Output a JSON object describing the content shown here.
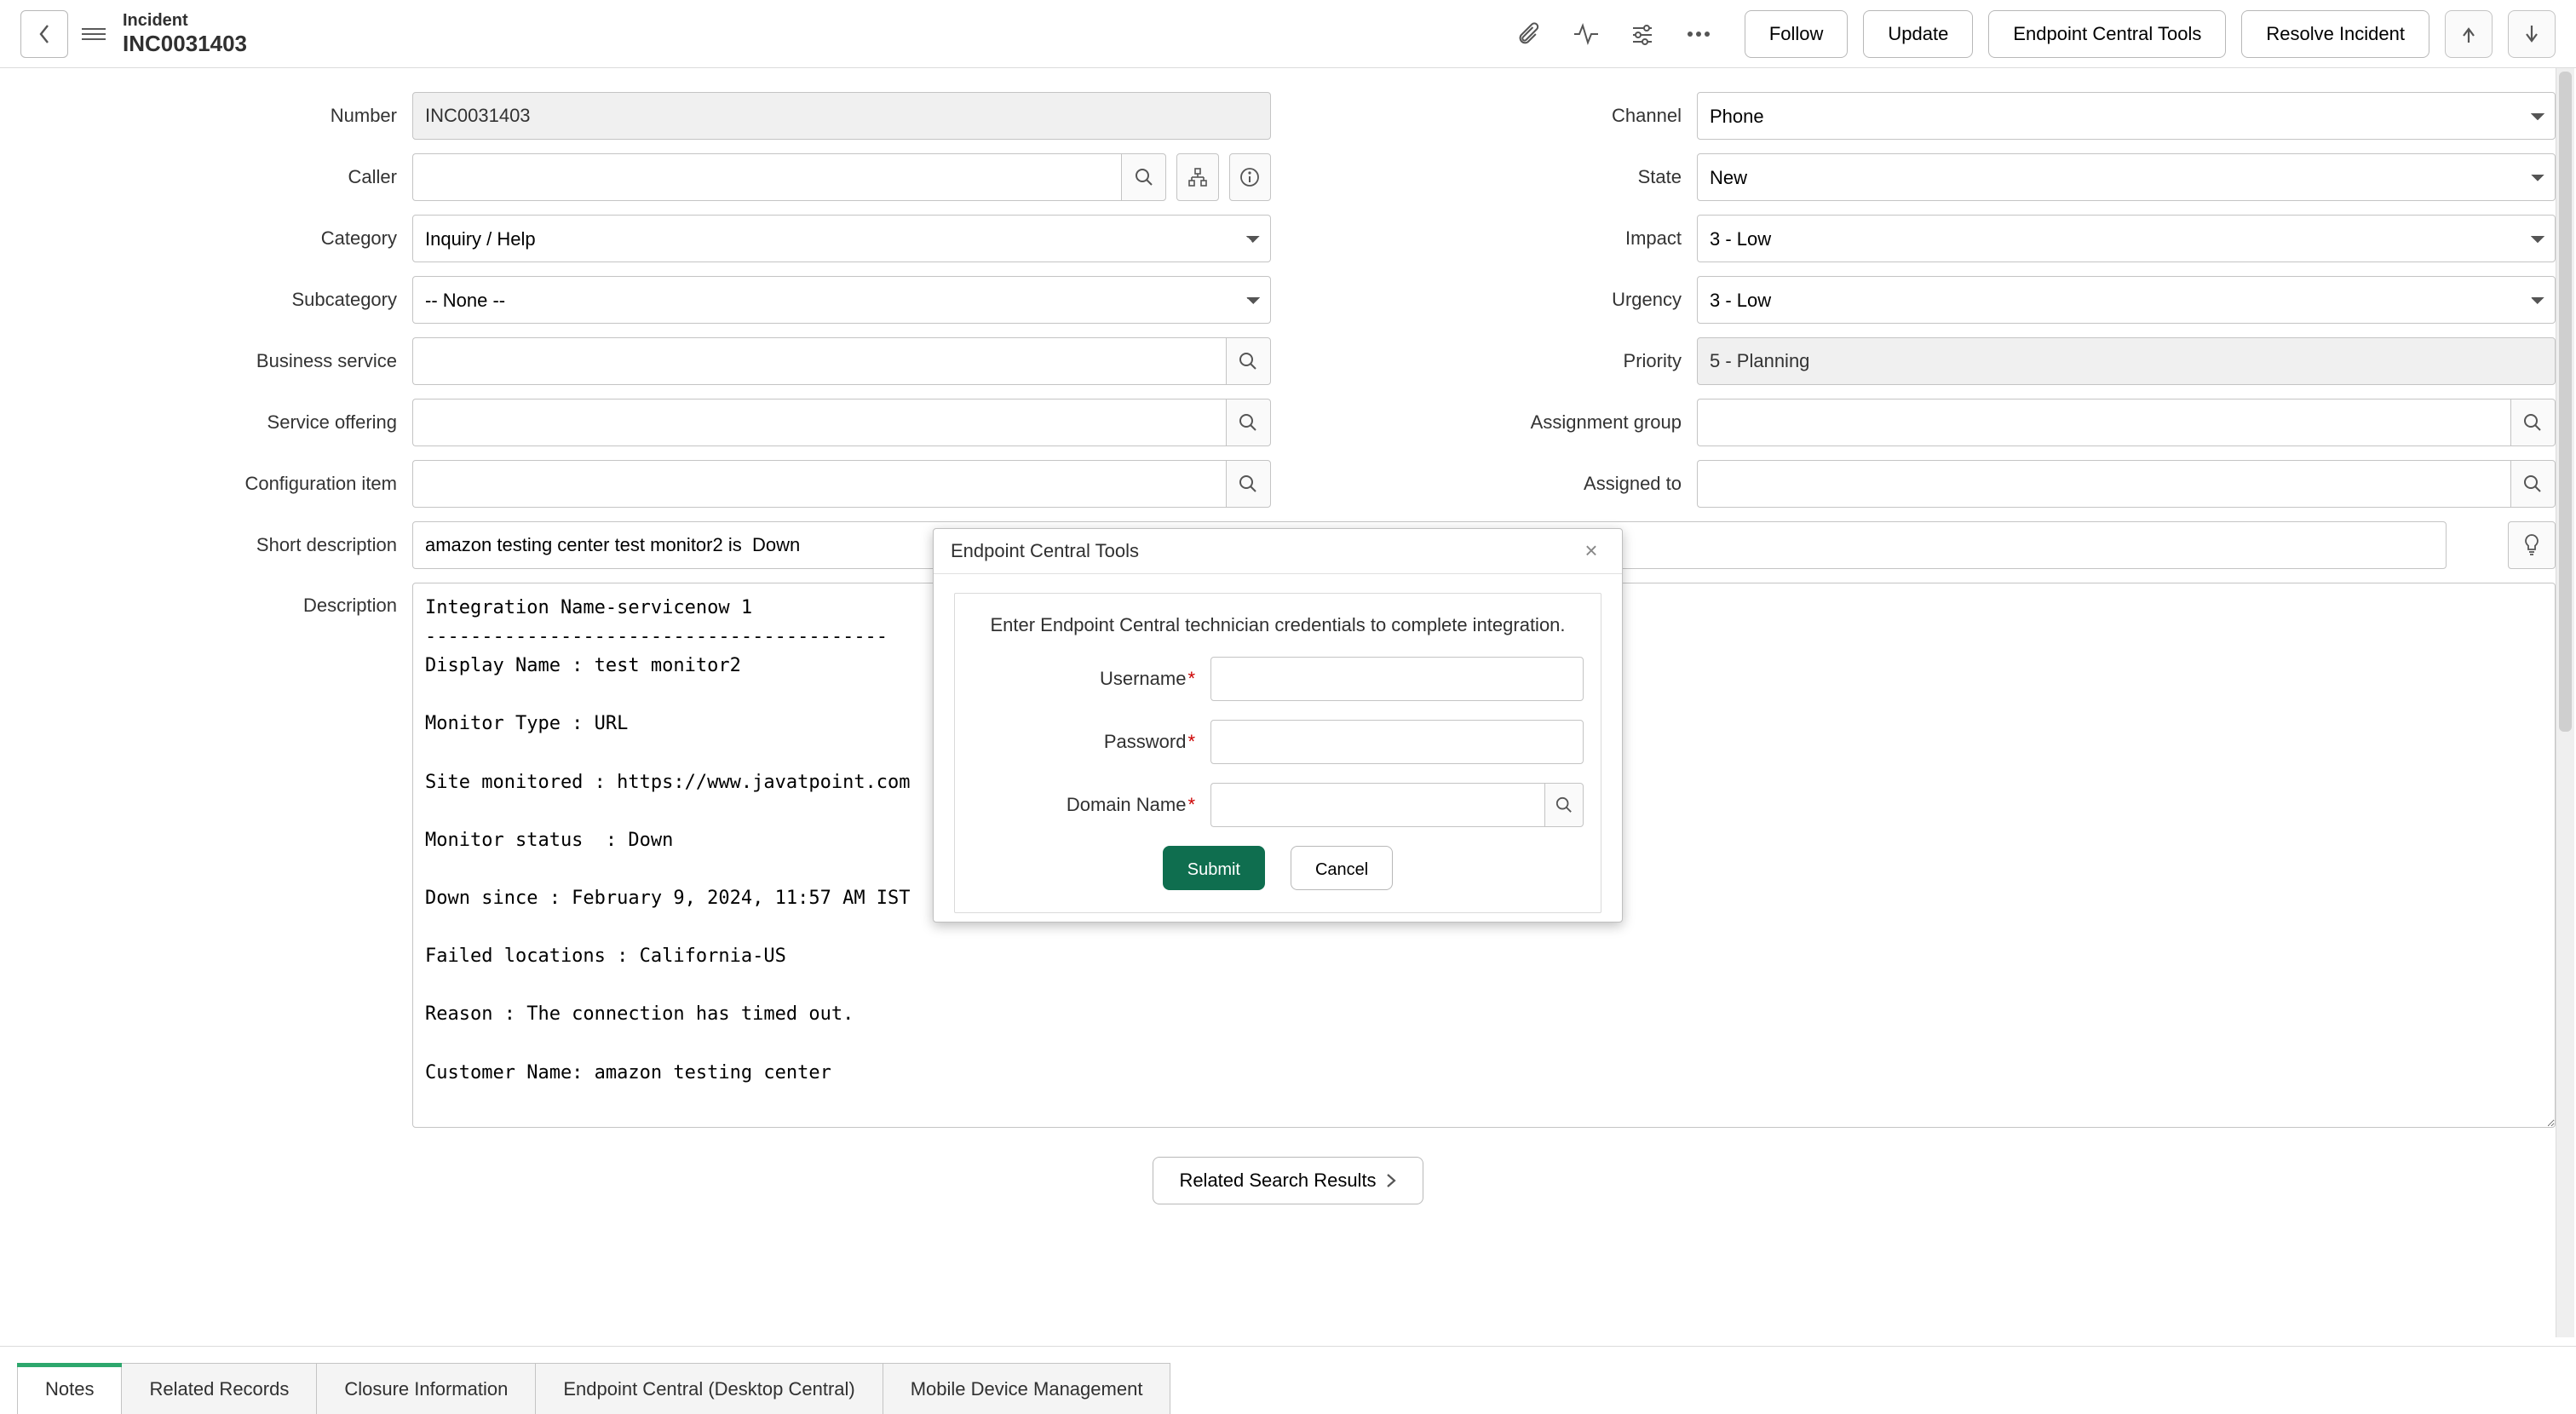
{
  "header": {
    "record_type": "Incident",
    "record_number": "INC0031403",
    "buttons": {
      "follow": "Follow",
      "update": "Update",
      "tools": "Endpoint Central Tools",
      "resolve": "Resolve Incident"
    }
  },
  "left": {
    "number": {
      "label": "Number",
      "value": "INC0031403"
    },
    "caller": {
      "label": "Caller",
      "value": ""
    },
    "category": {
      "label": "Category",
      "value": "Inquiry / Help"
    },
    "subcategory": {
      "label": "Subcategory",
      "value": "-- None --"
    },
    "business_service": {
      "label": "Business service",
      "value": ""
    },
    "service_offering": {
      "label": "Service offering",
      "value": ""
    },
    "configuration_item": {
      "label": "Configuration item",
      "value": ""
    }
  },
  "right": {
    "channel": {
      "label": "Channel",
      "value": "Phone"
    },
    "state": {
      "label": "State",
      "value": "New"
    },
    "impact": {
      "label": "Impact",
      "value": "3 - Low"
    },
    "urgency": {
      "label": "Urgency",
      "value": "3 - Low"
    },
    "priority": {
      "label": "Priority",
      "value": "5 - Planning"
    },
    "assignment_group": {
      "label": "Assignment group",
      "value": ""
    },
    "assigned_to": {
      "label": "Assigned to",
      "value": ""
    }
  },
  "full": {
    "short_description": {
      "label": "Short description",
      "value": "amazon testing center test monitor2 is  Down"
    },
    "description": {
      "label": "Description",
      "value": "Integration Name-servicenow 1\n-----------------------------------------\nDisplay Name : test monitor2\n\nMonitor Type : URL\n\nSite monitored : https://www.javatpoint.com\n\nMonitor status  : Down\n\nDown since : February 9, 2024, 11:57 AM IST\n\nFailed locations : California-US\n\nReason : The connection has timed out.\n\nCustomer Name: amazon testing center"
    }
  },
  "related": {
    "button": "Related Search Results"
  },
  "tabs": [
    {
      "label": "Notes",
      "active": true
    },
    {
      "label": "Related Records",
      "active": false
    },
    {
      "label": "Closure Information",
      "active": false
    },
    {
      "label": "Endpoint Central (Desktop Central)",
      "active": false
    },
    {
      "label": "Mobile Device Management",
      "active": false
    }
  ],
  "modal": {
    "title": "Endpoint Central Tools",
    "message": "Enter Endpoint Central technician credentials to complete integration.",
    "username": {
      "label": "Username",
      "value": ""
    },
    "password": {
      "label": "Password",
      "value": ""
    },
    "domain": {
      "label": "Domain Name",
      "value": ""
    },
    "submit": "Submit",
    "cancel": "Cancel"
  }
}
